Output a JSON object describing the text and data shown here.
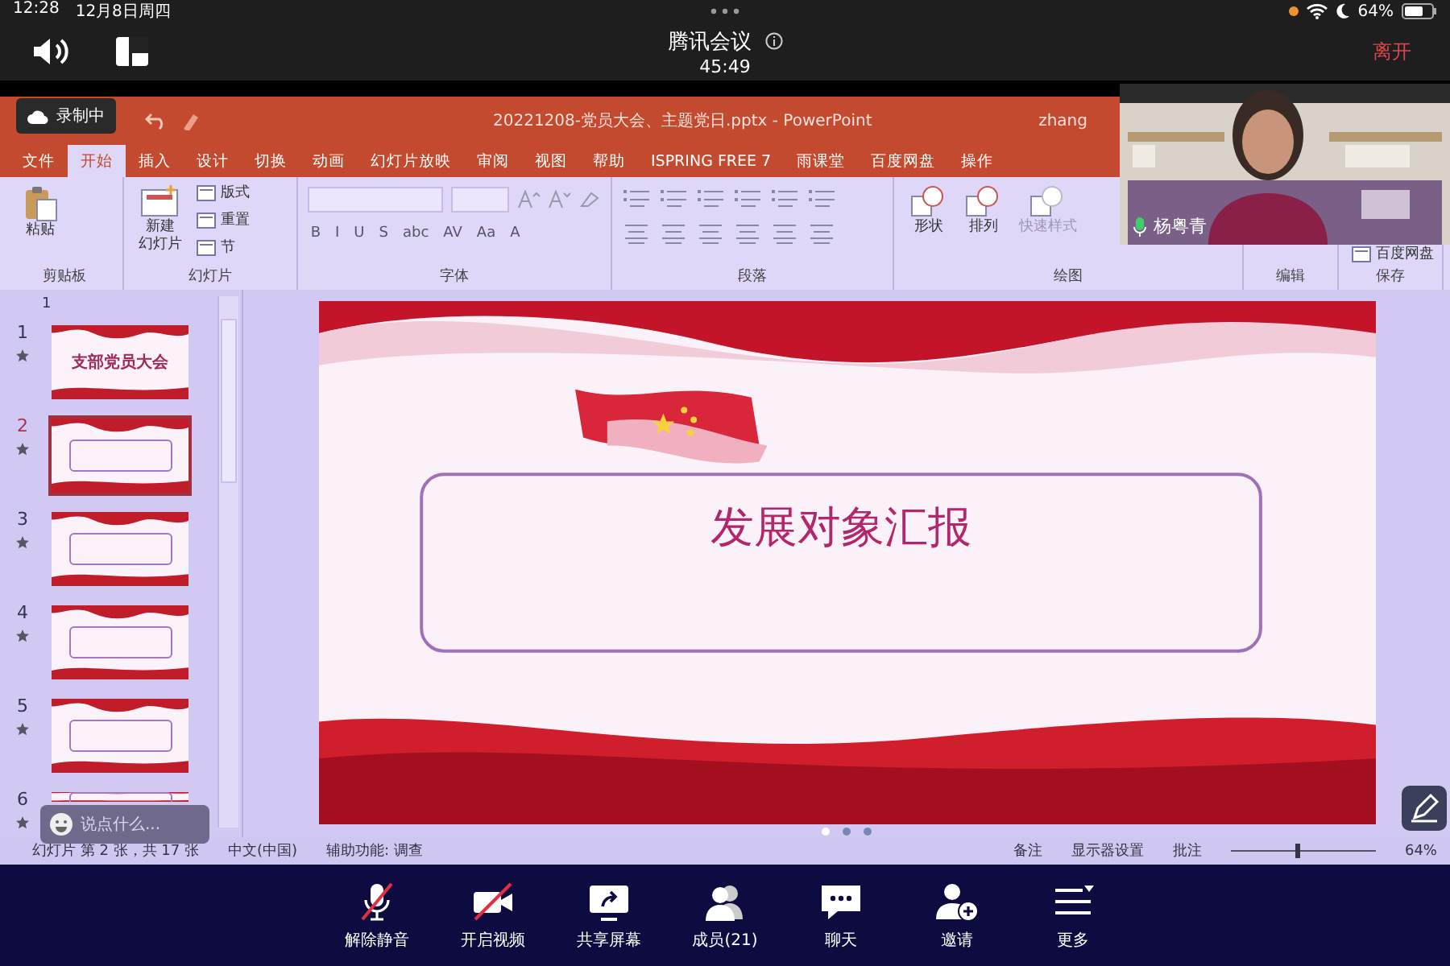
{
  "status_bar": {
    "time": "12:28",
    "date": "12月8日周四",
    "battery": "64%"
  },
  "meeting_bar": {
    "title": "腾讯会议",
    "timer": "45:49",
    "leave_button": "离开"
  },
  "recording_badge": "录制中",
  "powerpoint": {
    "title": "20221208-党员大会、主题党日.pptx  -  PowerPoint",
    "user": "zhang",
    "tabs": [
      {
        "label": "文件",
        "selected": false
      },
      {
        "label": "开始",
        "selected": true
      },
      {
        "label": "插入",
        "selected": false
      },
      {
        "label": "设计",
        "selected": false
      },
      {
        "label": "切换",
        "selected": false
      },
      {
        "label": "动画",
        "selected": false
      },
      {
        "label": "幻灯片放映",
        "selected": false
      },
      {
        "label": "审阅",
        "selected": false
      },
      {
        "label": "视图",
        "selected": false
      },
      {
        "label": "帮助",
        "selected": false
      },
      {
        "label": "ISPRING FREE 7",
        "selected": false
      },
      {
        "label": "雨课堂",
        "selected": false
      },
      {
        "label": "百度网盘",
        "selected": false
      },
      {
        "label": "操作",
        "selected": false
      }
    ],
    "ribbon_groups": [
      {
        "label": "剪贴板",
        "kind": "clipboard",
        "items": [
          {
            "lines": [
              "粘贴"
            ],
            "kind": "large",
            "disabled": false
          }
        ]
      },
      {
        "label": "幻灯片",
        "kind": "slides",
        "items": [
          {
            "lines": [
              "新建",
              "幻灯片"
            ],
            "kind": "large",
            "disabled": false
          },
          {
            "label": "版式",
            "kind": "small",
            "disabled": false
          },
          {
            "label": "重置",
            "kind": "small",
            "disabled": false
          },
          {
            "label": "节",
            "kind": "small",
            "disabled": false
          }
        ]
      },
      {
        "label": "字体",
        "kind": "font",
        "items": [
          {
            "label": "B",
            "kind": "glyph",
            "disabled": false
          },
          {
            "label": "I",
            "kind": "glyph",
            "disabled": false
          },
          {
            "label": "U",
            "kind": "glyph",
            "disabled": false
          },
          {
            "label": "S",
            "kind": "glyph",
            "disabled": false
          },
          {
            "label": "abc",
            "kind": "glyph",
            "disabled": false
          },
          {
            "label": "AV",
            "kind": "glyph",
            "disabled": false
          },
          {
            "label": "Aa",
            "kind": "glyph",
            "disabled": false
          },
          {
            "label": "A",
            "kind": "glyph",
            "disabled": false
          }
        ]
      },
      {
        "label": "段落",
        "kind": "paragraph"
      },
      {
        "label": "绘图",
        "kind": "drawing",
        "items": [
          {
            "lines": [
              "形状"
            ],
            "kind": "large",
            "disabled": false
          },
          {
            "lines": [
              "排列"
            ],
            "kind": "large",
            "disabled": false
          },
          {
            "lines": [
              "快速样式"
            ],
            "kind": "large",
            "disabled": true
          }
        ]
      },
      {
        "label": "编辑",
        "kind": "editing"
      },
      {
        "label": "保存",
        "kind": "save",
        "items": [
          {
            "label": "百度网盘",
            "kind": "small",
            "disabled": false
          }
        ]
      }
    ],
    "section": "1",
    "thumbnails": [
      {
        "number": "1",
        "selected": false,
        "title": "支部党员大会"
      },
      {
        "number": "2",
        "selected": true
      },
      {
        "number": "3",
        "selected": false
      },
      {
        "number": "4",
        "selected": false
      },
      {
        "number": "5",
        "selected": false
      },
      {
        "number": "6",
        "selected": false
      }
    ],
    "slide": {
      "title": "发展对象汇报"
    },
    "status_left": [
      "幻灯片 第 2 张，共 17 张",
      "中文(中国)",
      "辅助功能: 调查"
    ],
    "status_right": [
      "备注",
      "显示器设置",
      "批注"
    ],
    "zoom": {
      "level": 0.45,
      "reading": "64%"
    }
  },
  "pager": [
    {
      "selected": true
    },
    {
      "selected": false
    },
    {
      "selected": false
    }
  ],
  "chat_input": {
    "placeholder": "说点什么..."
  },
  "video": {
    "name": "杨粤青"
  },
  "toolbar": [
    {
      "label": "解除静音",
      "kind": "mic-muted"
    },
    {
      "label": "开启视频",
      "kind": "camera-off"
    },
    {
      "label": "共享屏幕",
      "kind": "share"
    },
    {
      "label": "成员(21)",
      "kind": "members"
    },
    {
      "label": "聊天",
      "kind": "chat"
    },
    {
      "label": "邀请",
      "kind": "invite"
    },
    {
      "label": "更多",
      "kind": "more"
    }
  ]
}
